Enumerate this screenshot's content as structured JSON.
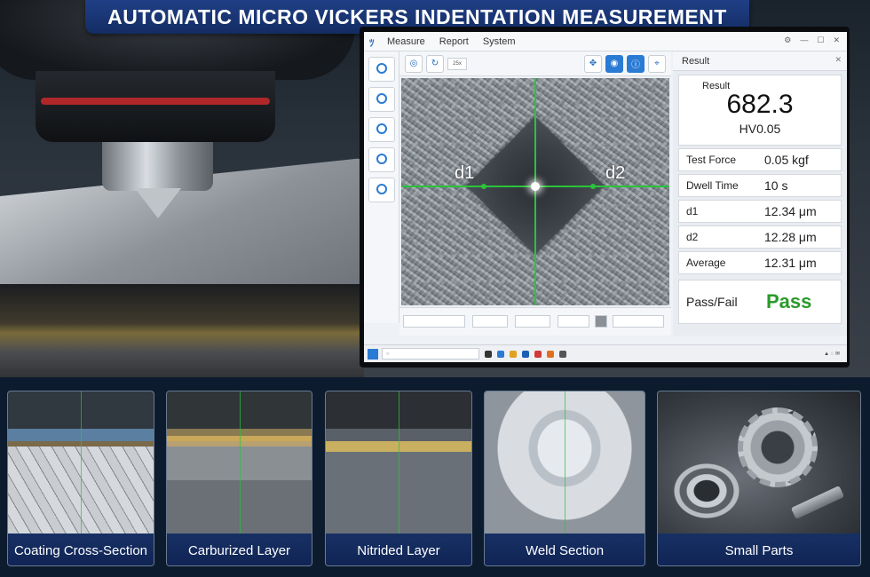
{
  "banner": {
    "title": "AUTOMATIC MICRO VICKERS INDENTATION MEASUREMENT"
  },
  "app": {
    "menu": [
      "Measure",
      "Report",
      "System"
    ],
    "toolbar": {
      "zoom_select": "25x"
    },
    "image_labels": {
      "d1": "d1",
      "d2": "d2"
    },
    "result_panel": {
      "header": "Result",
      "result_label": "Result",
      "hardness_value": "682.3",
      "hardness_unit": "HV0.05",
      "rows": [
        {
          "key": "Test Force",
          "value": "0.05 kgf"
        },
        {
          "key": "Dwell Time",
          "value": "10 s"
        },
        {
          "key": "d1",
          "value": "12.34 μm"
        },
        {
          "key": "d2",
          "value": "12.28 μm"
        },
        {
          "key": "Average",
          "value": "12.31 μm"
        }
      ],
      "pass_fail": {
        "key": "Pass/Fail",
        "value": "Pass",
        "color": "#2a9a2a"
      }
    }
  },
  "tiles": [
    {
      "caption": "Coating Cross-Section"
    },
    {
      "caption": "Carburized Layer"
    },
    {
      "caption": "Nitrided Layer"
    },
    {
      "caption": "Weld Section"
    },
    {
      "caption": "Small Parts"
    }
  ],
  "colors": {
    "banner": "#1f3f86",
    "measure_lines": "#29c43a",
    "pass": "#2a9a2a",
    "caption_bar": "#173064"
  }
}
